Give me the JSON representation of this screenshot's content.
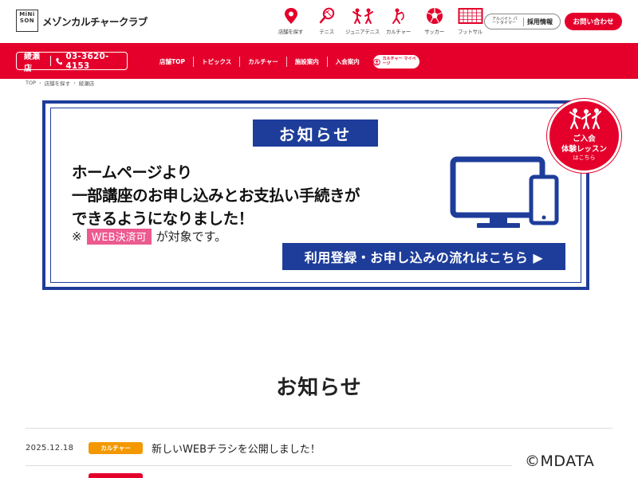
{
  "header": {
    "logo_mark": "MiNi SON",
    "logo_text": "メゾンカルチャークラブ",
    "categories": [
      {
        "label": "店舗を探す",
        "icon": "map-pin-icon"
      },
      {
        "label": "テニス",
        "icon": "tennis-icon"
      },
      {
        "label": "ジュニアテニス",
        "icon": "junior-tennis-icon"
      },
      {
        "label": "カルチャー",
        "icon": "culture-icon"
      },
      {
        "label": "サッカー",
        "icon": "soccer-ball-icon"
      },
      {
        "label": "フットサル",
        "icon": "futsal-goal-icon"
      }
    ],
    "recruit_small": "アルバイト パートタイマー",
    "recruit_label": "採用情報",
    "contact_label": "お問い合わせ"
  },
  "navbar": {
    "store_name": "綾瀬店",
    "phone": "03-3620-4153",
    "links": [
      "店舗TOP",
      "トピックス",
      "カルチャー",
      "施設案内",
      "入会案内"
    ],
    "mypage_label": "カルチャー マイページ"
  },
  "breadcrumb": [
    "TOP",
    "店舗を探す",
    "綾瀬店"
  ],
  "banner": {
    "title": "お知らせ",
    "lines": [
      "ホームページより",
      "一部講座のお申し込みとお支払い手続きが",
      "できるようになりました！"
    ],
    "note_prefix": "※",
    "note_badge": "WEB決済可",
    "note_suffix": "が対象です。",
    "flow_button": "利用登録・お申し込みの流れはこちら ▶"
  },
  "trial_badge": {
    "line1": "ご入会",
    "line2": "体験レッスン",
    "line3": "はこちら"
  },
  "news": {
    "heading": "お知らせ",
    "items": [
      {
        "date": "2025.12.18",
        "tag": "カルチャー",
        "title": "新しいWEBチラシを公開しました！"
      }
    ]
  },
  "copyright": "©MDATA",
  "colors": {
    "brand_red": "#e4002b",
    "banner_blue": "#1e3d9a",
    "badge_pink": "#ec5a8f",
    "tag_orange": "#f39800"
  }
}
